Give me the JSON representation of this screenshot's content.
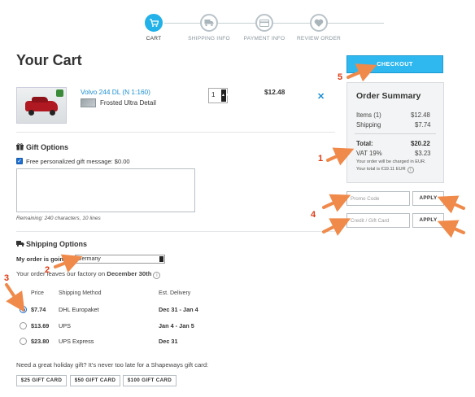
{
  "steps": [
    {
      "label": "CART",
      "icon": "cart-icon",
      "active": true
    },
    {
      "label": "SHIPPING INFO",
      "icon": "truck-icon",
      "active": false
    },
    {
      "label": "PAYMENT INFO",
      "icon": "credit-card-icon",
      "active": false
    },
    {
      "label": "REVIEW ORDER",
      "icon": "heart-icon",
      "active": false
    }
  ],
  "page_title": "Your Cart",
  "item": {
    "name": "Volvo 244 DL (N 1:160)",
    "material": "Frosted Ultra Detail",
    "quantity": "1",
    "price": "$12.48",
    "remove_icon": "close-icon"
  },
  "gift_options": {
    "title": "Gift Options",
    "checkbox_label": "Free personalized gift message: $0.00",
    "message_value": "",
    "remaining": "Remaining: 240 characters, 10 lines"
  },
  "shipping": {
    "title": "Shipping Options",
    "going_to_label": "My order is going to",
    "country": "Germany",
    "leaves_prefix": "Your order leaves our factory on",
    "leaves_date": "December 30th",
    "columns": [
      "Price",
      "Shipping Method",
      "Est. Delivery"
    ],
    "options": [
      {
        "price": "$7.74",
        "method": "DHL Europaket",
        "delivery": "Dec 31 - Jan 4",
        "selected": true
      },
      {
        "price": "$13.69",
        "method": "UPS",
        "delivery": "Jan 4 - Jan 5",
        "selected": false
      },
      {
        "price": "$23.80",
        "method": "UPS Express",
        "delivery": "Dec 31",
        "selected": false
      }
    ]
  },
  "gift_cards": {
    "prompt": "Need a great holiday gift? It's never too late for a Shapeways gift card:",
    "buttons": [
      "$25 GIFT CARD",
      "$50 GIFT CARD",
      "$100 GIFT CARD"
    ]
  },
  "checkout_label": "CHECKOUT",
  "summary": {
    "title": "Order Summary",
    "items_label": "Items (1)",
    "items_value": "$12.48",
    "shipping_label": "Shipping",
    "shipping_value": "$7.74",
    "total_label": "Total:",
    "total_value": "$20.22",
    "vat_label": "VAT 19%",
    "vat_value": "$3.23",
    "note1": "Your order will be charged in EUR.",
    "note2": "Your total is €19.11 EUR"
  },
  "promo_placeholder": "Promo Code",
  "gift_card_placeholder": "Credit / Gift Card",
  "apply_label": "APPLY",
  "annotations": [
    "1",
    "2",
    "3",
    "4",
    "5"
  ],
  "colors": {
    "accent": "#22b1e8",
    "link": "#1c8fd2",
    "annotation": "#e03a12",
    "arrow": "#f08a4b"
  }
}
